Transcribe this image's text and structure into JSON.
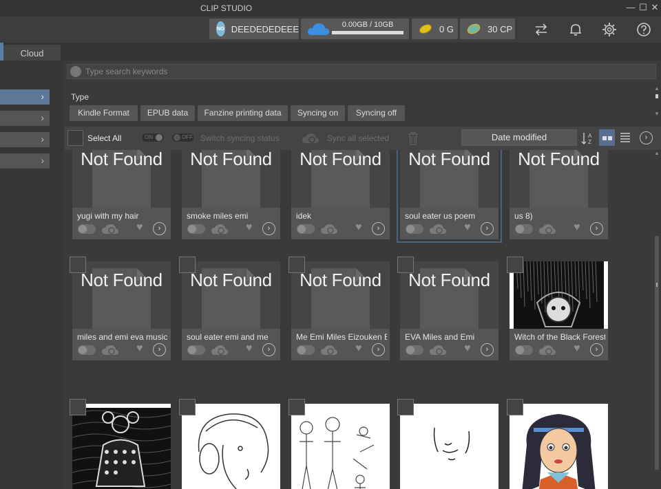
{
  "window": {
    "title": "CLIP STUDIO",
    "controls": [
      "—",
      "☐",
      "✕"
    ]
  },
  "topbar": {
    "user": {
      "avatar_text": "NO",
      "name": "DEEDEDEDEEE"
    },
    "storage": {
      "label": "0.00GB / 10GB",
      "used_fraction": 0.0
    },
    "gold": "0 G",
    "cp": "30 CP",
    "icons": [
      "sync-arrows-icon",
      "bell-icon",
      "gear-icon",
      "help-icon"
    ]
  },
  "tabs": [
    {
      "label": "Cloud"
    }
  ],
  "search": {
    "placeholder": "Type search keywords"
  },
  "filter": {
    "label": "Type",
    "chips": [
      "Kindle Format",
      "EPUB data",
      "Fanzine printing data",
      "Syncing on",
      "Syncing off"
    ]
  },
  "toolbar": {
    "select_all": "Select All",
    "toggle_on": "ON",
    "toggle_off": "OFF",
    "switch_syncing": "Switch syncing status",
    "sync_all": "Sync all selected",
    "sort": "Date modified"
  },
  "placeholder_text": "Not Found",
  "cards": [
    {
      "name": "yugi with my hair",
      "thumb": "notfound"
    },
    {
      "name": "smoke miles emi",
      "thumb": "notfound"
    },
    {
      "name": "idek",
      "thumb": "notfound"
    },
    {
      "name": "soul eater us poem",
      "thumb": "notfound",
      "selected": true
    },
    {
      "name": "us 8)",
      "thumb": "notfound"
    },
    {
      "name": "miles and emi eva music",
      "thumb": "notfound"
    },
    {
      "name": "soul eater emi and me",
      "thumb": "notfound"
    },
    {
      "name": "Me Emi Miles Eizouken Boat",
      "thumb": "notfound"
    },
    {
      "name": "EVA Miles and Emi",
      "thumb": "notfound"
    },
    {
      "name": "Witch of the Black Forest Emi",
      "thumb": "dark-forest-art"
    },
    {
      "name": "",
      "thumb": "dark-bug-art"
    },
    {
      "name": "",
      "thumb": "headphones-sketch"
    },
    {
      "name": "",
      "thumb": "figures-sketch"
    },
    {
      "name": "",
      "thumb": "face-sketch"
    },
    {
      "name": "",
      "thumb": "anime-girl-art"
    }
  ]
}
